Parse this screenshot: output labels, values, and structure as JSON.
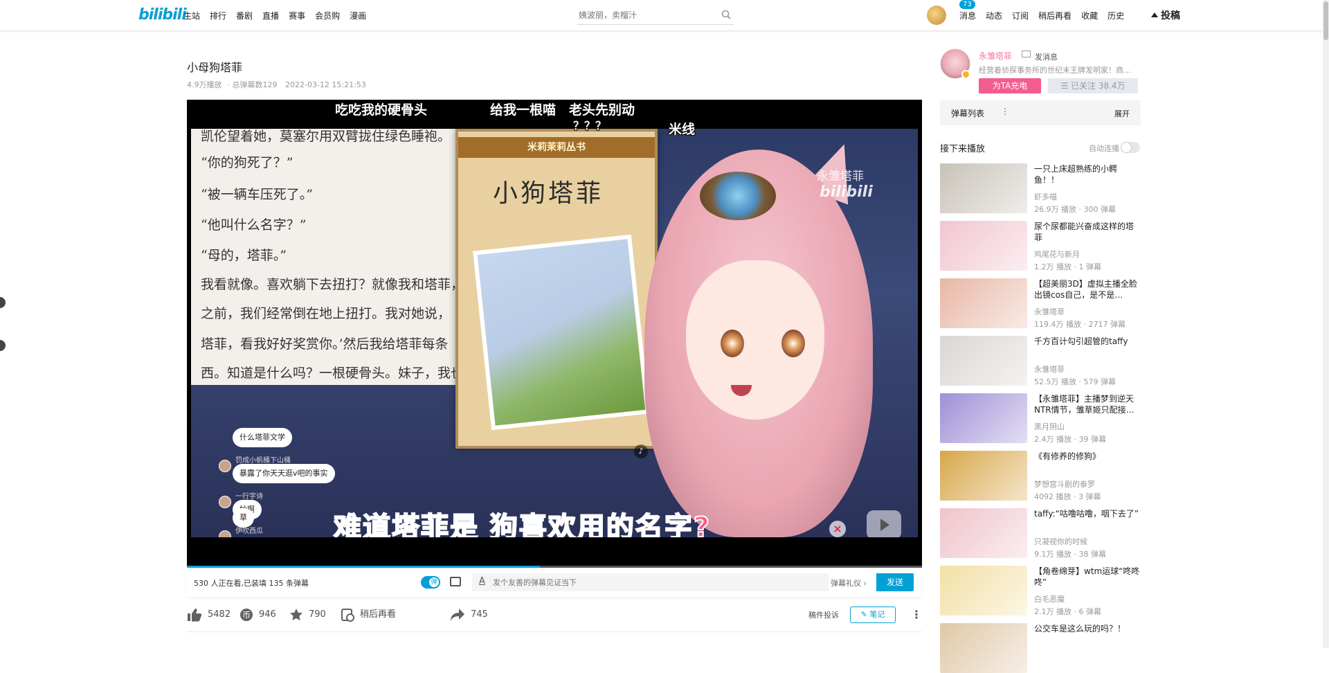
{
  "nav": {
    "logo": "bilibili",
    "links": [
      "主站",
      "排行",
      "番剧",
      "直播",
      "赛事",
      "会员购",
      "漫画"
    ],
    "search_placeholder": "姨波丽，卖榴汁",
    "msg_count": "73",
    "right_links": [
      "消息",
      "动态",
      "订阅",
      "稍后再看",
      "收藏",
      "历史"
    ],
    "upload": "投稿"
  },
  "video": {
    "title": "小母狗塔菲",
    "views": "4.9万播放",
    "danmaku_total": "总弹幕数129",
    "date": "2022-03-12 15:21:53"
  },
  "player": {
    "danmaku": [
      "吃吃我的硬骨头",
      "给我一根喵",
      "老头先别动",
      "？？？",
      "米线"
    ],
    "book_lines": [
      "凯伦望着她，莫塞尔用双臂拢住绿色睡袍。",
      "“你的狗死了？”",
      "“被一辆车压死了。”",
      "“他叫什么名字？”",
      "“母的，塔菲。”",
      "我看就像。喜欢躺下去扭打？就像我和塔菲，",
      "之前，我们经常倒在地上扭打。我对她说，",
      "塔菲，看我好好奖赏你。’然后我给塔菲每条",
      "西。知道是什么吗？一根硬骨头。妹子，我也可"
    ],
    "book_series": "米莉茉莉丛书",
    "book_title": "小狗塔菲",
    "watermark_name": "永雏塔菲",
    "watermark_logo": "bilibili",
    "comments": [
      {
        "name": "",
        "text": "什么塔菲文学"
      },
      {
        "name": "罚成小帆桶下山桶",
        "text": "暴露了你天天逛v吧的事实"
      },
      {
        "name": "一行字诗",
        "text": "妙啊"
      },
      {
        "name": "伊吹西瓜",
        "text": "草"
      }
    ],
    "subtitle": "难道塔菲是 狗喜欢用的名字?",
    "progress": 0.48
  },
  "sendbar": {
    "viewers": "530 人正在看,已装填 135 条弹幕",
    "placeholder": "发个友善的弹幕见证当下",
    "etiquette": "弹幕礼仪 ›",
    "send": "发送"
  },
  "actions": {
    "like": "5482",
    "coin": "946",
    "favorite": "790",
    "watch_later": "稍后再看",
    "share": "745",
    "report": "稿件投诉",
    "note": "笔记"
  },
  "up": {
    "name": "永雏塔菲",
    "send_message": "发消息",
    "desc": "经营着侦探事务所的世纪末王牌发明家！商务…",
    "charge": "为TA充电",
    "follow": "已关注 38.4万"
  },
  "danmaku_list": {
    "title": "弹幕列表",
    "expand": "展开"
  },
  "next": {
    "title": "接下来播放",
    "autoplay": "自动连播"
  },
  "recommendations": [
    {
      "title": "一只上床超熟练的小鳄鱼！！",
      "up": "虾多喵",
      "stat": "26.9万 播放 · 300 弹幕",
      "color": "#c8c2b8"
    },
    {
      "title": "尿个尿都能兴奋成这样的塔菲",
      "up": "鸡尾花与新月",
      "stat": "1.2万 播放 · 1 弹幕",
      "color": "#f2c4cf"
    },
    {
      "title": "【超美丽3D】虚拟主播全脸出镜cos自己，是不是…",
      "up": "永雏塔菲",
      "stat": "119.4万 播放 · 2717 弹幕",
      "color": "#e8b7a6"
    },
    {
      "title": "千方百计勾引超管的taffy",
      "up": "永雏塔菲",
      "stat": "52.5万 播放 · 579 弹幕",
      "color": "#d9d6d3"
    },
    {
      "title": "【永雏塔菲】主播梦到逆天NTR情节，雏草姬只配接…",
      "up": "黑月阴山",
      "stat": "2.4万 播放 · 39 弹幕",
      "color": "#9f8fd6"
    },
    {
      "title": "《有修养的修狗》",
      "up": "梦想宫斗剧的泰罗",
      "stat": "4092 播放 · 3 弹幕",
      "color": "#d8a64a"
    },
    {
      "title": "taffy:“咕噜咕噜，咽下去了”",
      "up": "只凝视你的时候",
      "stat": "9.1万 播放 · 38 弹幕",
      "color": "#f0c3cb"
    },
    {
      "title": "【角卷绵芽】wtm运球“咚咚咚”",
      "up": "白毛恶魔",
      "stat": "2.1万 播放 · 6 弹幕",
      "color": "#f3e0a5"
    },
    {
      "title": "公交车是这么玩的吗？！",
      "up": "",
      "stat": "",
      "color": "#e0c8a8"
    }
  ]
}
